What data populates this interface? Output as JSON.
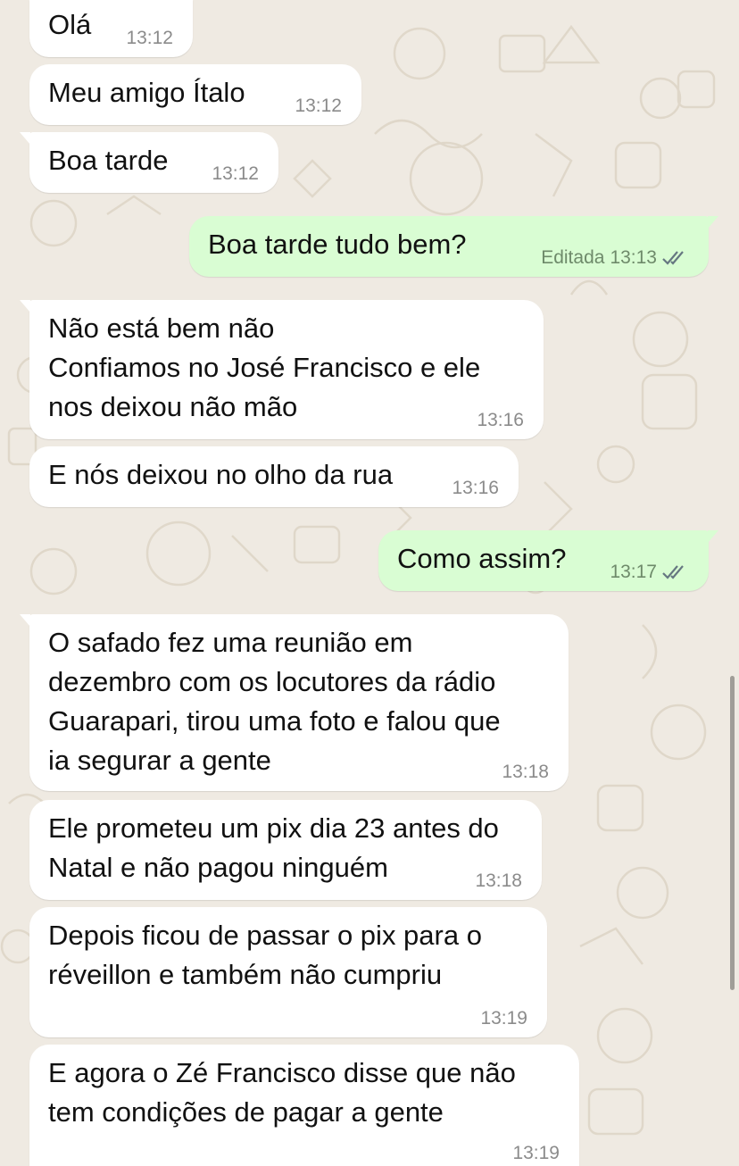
{
  "messages": [
    {
      "direction": "in",
      "text": "Olá",
      "time": "13:12"
    },
    {
      "direction": "in",
      "text": "Meu amigo Ítalo",
      "time": "13:12"
    },
    {
      "direction": "in",
      "text": "Boa tarde",
      "time": "13:12"
    },
    {
      "direction": "out",
      "text": "Boa tarde tudo bem?",
      "edited_label": "Editada",
      "time": "13:13",
      "status": "read-double-check-icon"
    },
    {
      "direction": "in",
      "text": "Não está bem não\nConfiamos no José Francisco e ele\nnos deixou não mão",
      "time": "13:16"
    },
    {
      "direction": "in",
      "text": "E nós deixou no olho da rua",
      "time": "13:16"
    },
    {
      "direction": "out",
      "text": "Como assim?",
      "time": "13:17",
      "status": "read-double-check-icon"
    },
    {
      "direction": "in",
      "text": "O safado fez uma reunião em\ndezembro com os locutores da rádio\nGuarapari, tirou uma foto e falou que\nia segurar a gente",
      "time": "13:18"
    },
    {
      "direction": "in",
      "text": "Ele prometeu um pix dia 23 antes do\nNatal e não pagou ninguém",
      "time": "13:18"
    },
    {
      "direction": "in",
      "text": "Depois ficou de passar o pix para o\nréveillon e também não cumpriu",
      "time": "13:19"
    },
    {
      "direction": "in",
      "text": "E agora o Zé Francisco disse que não\ntem condições de pagar a gente",
      "time": "13:19"
    }
  ],
  "colors": {
    "background": "#efeae2",
    "incoming_bubble": "#ffffff",
    "outgoing_bubble": "#d9fdd3",
    "timestamp": "#8b8b8b"
  }
}
